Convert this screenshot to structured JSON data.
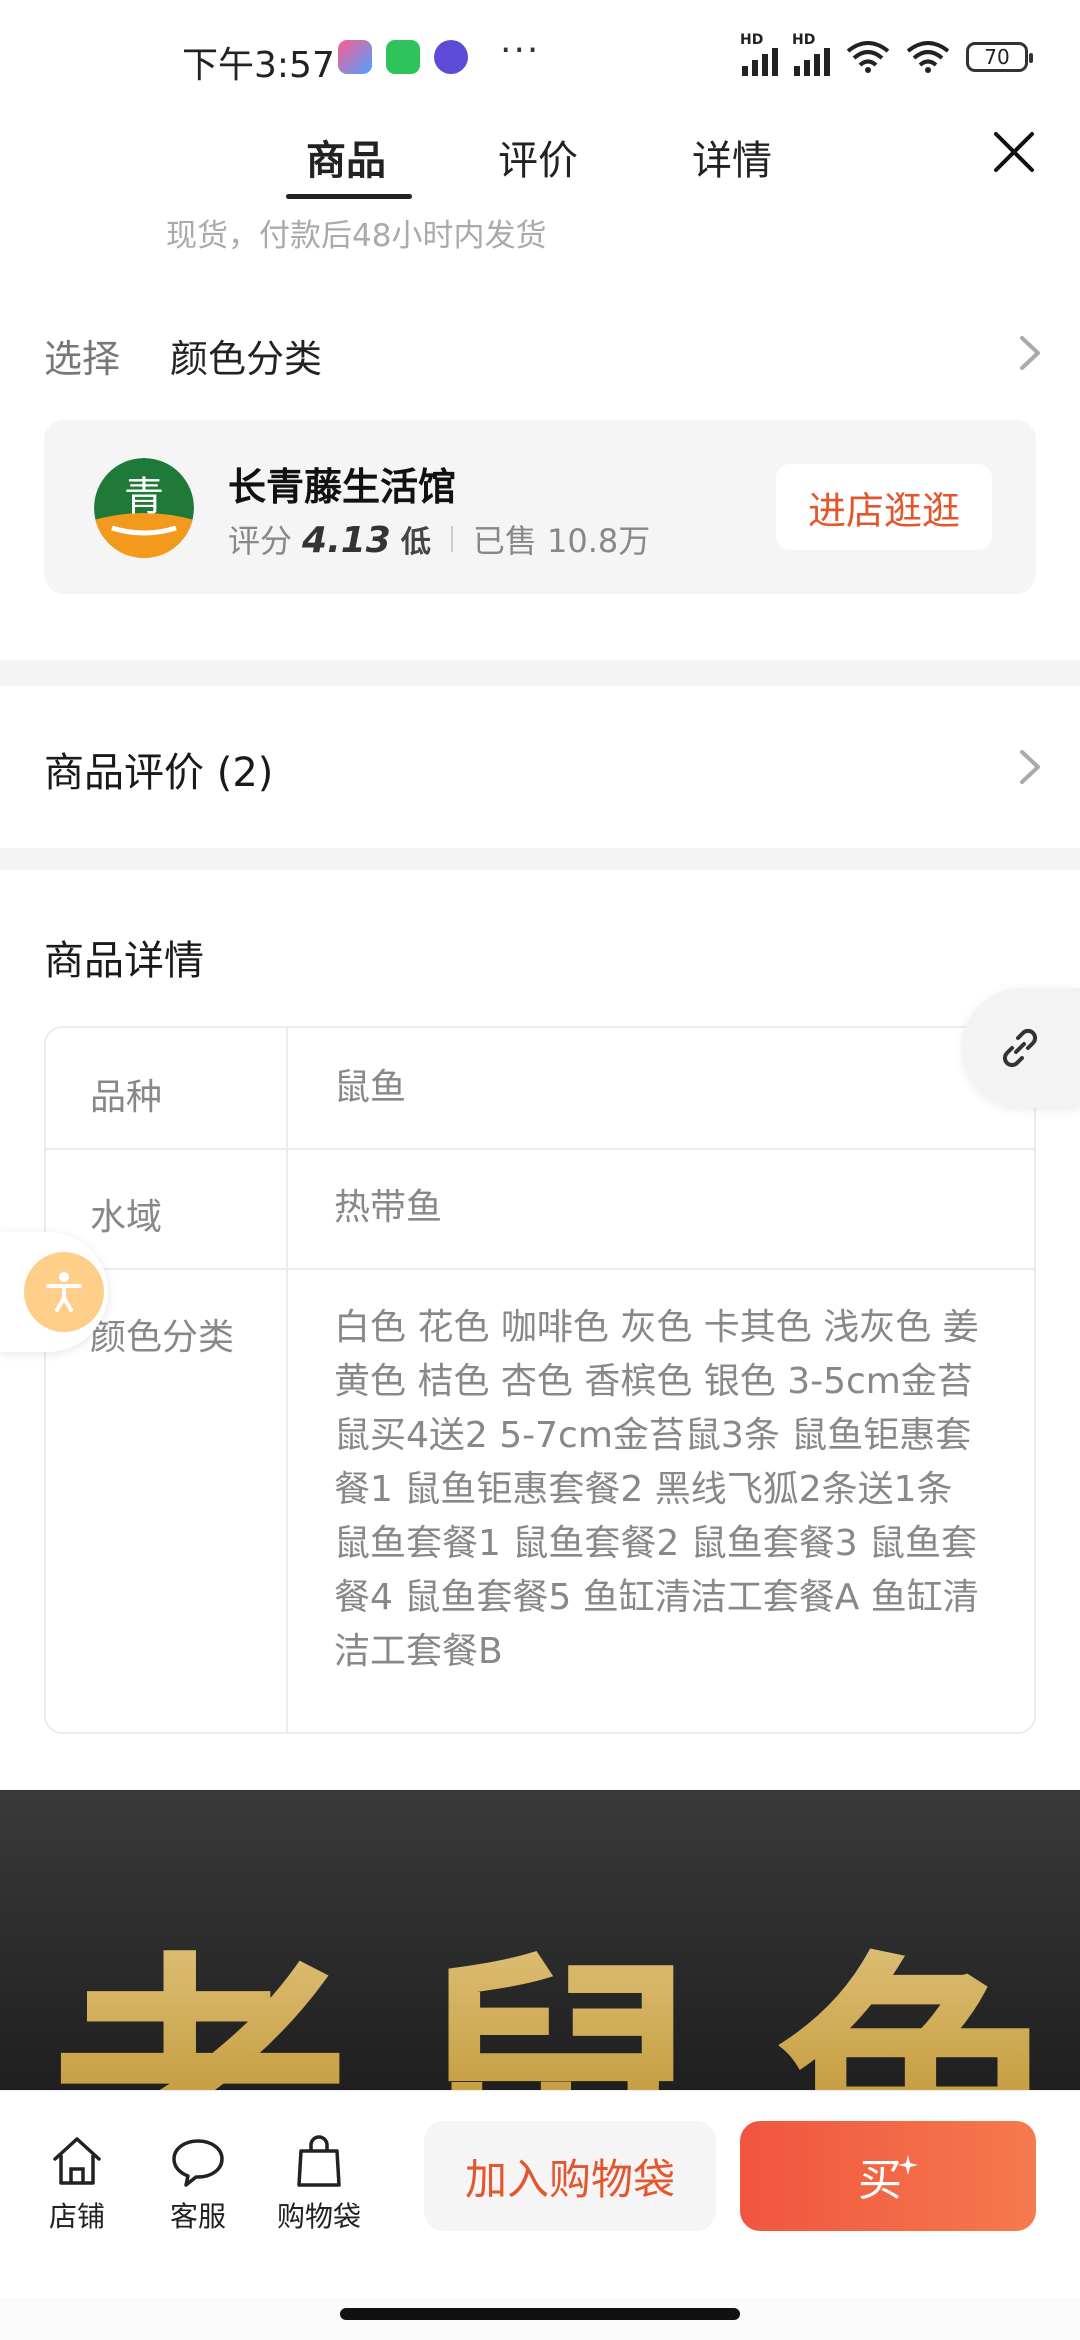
{
  "status_bar": {
    "time": "下午3:57",
    "battery": "70",
    "dots": "···",
    "signal_hd": "HD"
  },
  "tabs": [
    "商品",
    "评价",
    "详情"
  ],
  "shipping_note": "现货，付款后48小时内发货",
  "select": {
    "label": "选择",
    "value": "颜色分类"
  },
  "shop": {
    "logo_char": "青",
    "name": "长青藤生活馆",
    "score_label": "评分",
    "score": "4.13",
    "level": "低",
    "sold": "已售 10.8万",
    "enter_button": "进店逛逛"
  },
  "reviews": {
    "title": "商品评价 (2)"
  },
  "details": {
    "title": "商品详情",
    "specs": [
      {
        "key": "品种",
        "value": "鼠鱼"
      },
      {
        "key": "水域",
        "value": "热带鱼"
      },
      {
        "key": "颜色分类",
        "value": "白色 花色 咖啡色 灰色 卡其色 浅灰色 姜黄色 桔色 杏色 香槟色 银色 3-5cm金苔鼠买4送2 5-7cm金苔鼠3条 鼠鱼钜惠套餐1 鼠鱼钜惠套餐2 黑线飞狐2条送1条 鼠鱼套餐1 鼠鱼套餐2 鼠鱼套餐3 鼠鱼套餐4 鼠鱼套餐5 鱼缸清洁工套餐A 鱼缸清洁工套餐B"
      }
    ]
  },
  "banner": {
    "text": "老鼠鱼"
  },
  "bottom_bar": {
    "nav": [
      {
        "label": "店铺",
        "icon": "home-icon"
      },
      {
        "label": "客服",
        "icon": "chat-bubble-icon"
      },
      {
        "label": "购物袋",
        "icon": "bag-icon"
      }
    ],
    "add_to_cart": "加入购物袋",
    "buy": "买"
  },
  "colors": {
    "accent": "#e4572e",
    "buy_gradient_start": "#f0553f",
    "buy_gradient_end": "#f57a4c"
  }
}
